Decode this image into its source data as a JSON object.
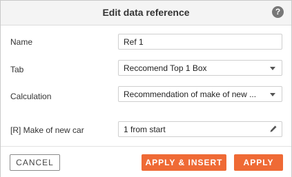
{
  "dialog": {
    "title": "Edit data reference",
    "help_icon": "question-circle-icon",
    "help_glyph": "?"
  },
  "form": {
    "name": {
      "label": "Name",
      "value": "Ref 1"
    },
    "tab": {
      "label": "Tab",
      "value": "Reccomend Top 1 Box"
    },
    "calculation": {
      "label": "Calculation",
      "value": "Recommendation of make of new ..."
    },
    "make": {
      "label": "[R] Make of new car",
      "value": "1 from start",
      "icon": "pencil-icon"
    }
  },
  "buttons": {
    "cancel": "CANCEL",
    "apply_insert": "APPLY & INSERT",
    "apply": "APPLY"
  },
  "colors": {
    "accent": "#ef6a35",
    "header_bg": "#f4f4f4",
    "help_bg": "#777777"
  }
}
